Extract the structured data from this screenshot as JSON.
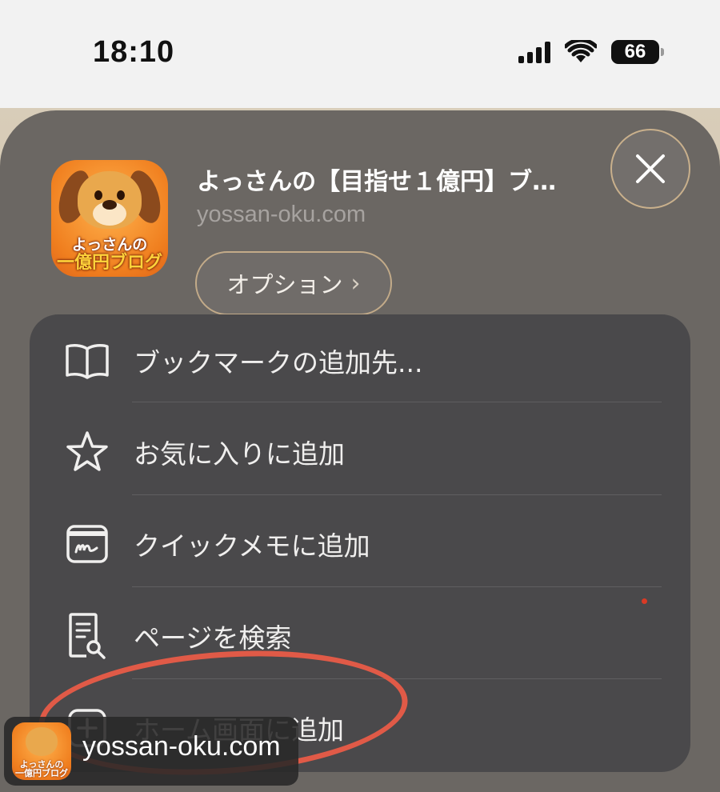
{
  "status_bar": {
    "time": "18:10",
    "battery": "66"
  },
  "site": {
    "title": "よっさんの【目指せ１億円】ブ…",
    "domain": "yossan-oku.com",
    "icon_text_line1": "よっさんの",
    "icon_text_line2": "一億円ブログ"
  },
  "options_button": {
    "label": "オプション",
    "chevron": "›"
  },
  "menu": {
    "items": [
      {
        "label": "ブックマークの追加先...",
        "icon": "book-icon"
      },
      {
        "label": "お気に入りに追加",
        "icon": "star-icon"
      },
      {
        "label": "クイックメモに追加",
        "icon": "quick-note-icon"
      },
      {
        "label": "ページを検索",
        "icon": "find-in-page-icon"
      },
      {
        "label": "ホーム画面に追加",
        "icon": "add-square-icon"
      }
    ]
  },
  "watermark": {
    "text": "yossan-oku.com"
  },
  "colors": {
    "sheet": "#6b6763",
    "menu": "#4a494b",
    "annotation": "#e05a47",
    "accent_border": "#c3ab89"
  }
}
